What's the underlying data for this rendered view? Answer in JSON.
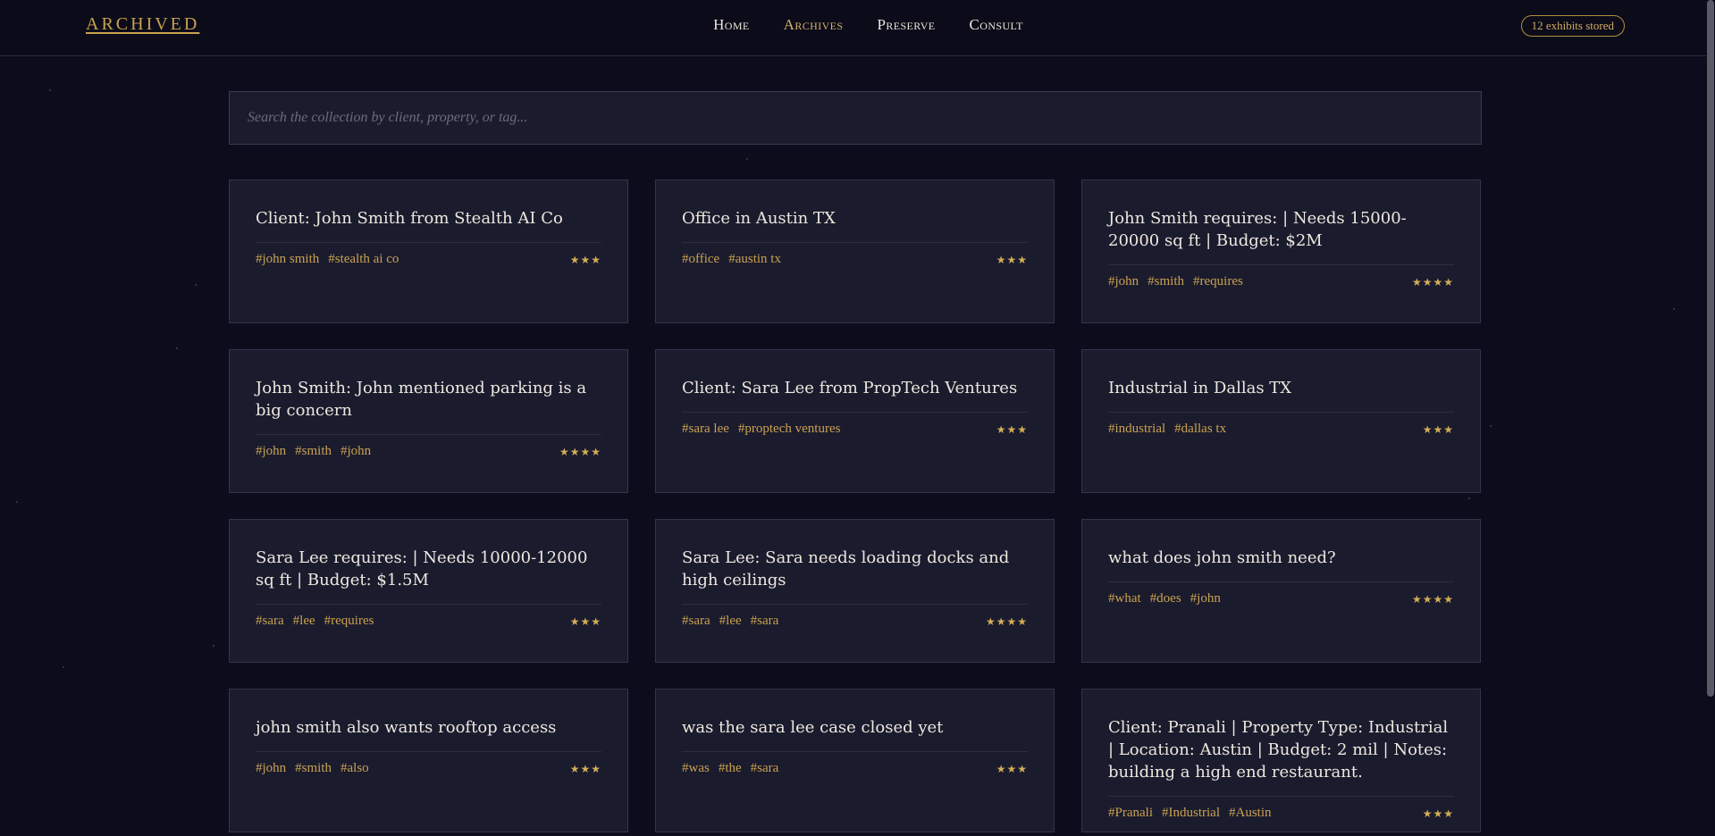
{
  "header": {
    "logo": "ARCHIVED",
    "nav": [
      "Home",
      "Archives",
      "Preserve",
      "Consult"
    ],
    "active_nav": "Archives",
    "counter": "12 exhibits stored"
  },
  "search": {
    "placeholder": "Search the collection by client, property, or tag...",
    "value": ""
  },
  "cards": [
    {
      "title": "Client: John Smith from Stealth AI Co",
      "tags": [
        "#john smith",
        "#stealth ai co"
      ],
      "rating": "★★★"
    },
    {
      "title": "Office in Austin TX",
      "tags": [
        "#office",
        "#austin tx"
      ],
      "rating": "★★★"
    },
    {
      "title": "John Smith requires: | Needs 15000-20000 sq ft | Budget: $2M",
      "tags": [
        "#john",
        "#smith",
        "#requires"
      ],
      "rating": "★★★★"
    },
    {
      "title": "John Smith: John mentioned parking is a big concern",
      "tags": [
        "#john",
        "#smith",
        "#john"
      ],
      "rating": "★★★★"
    },
    {
      "title": "Client: Sara Lee from PropTech Ventures",
      "tags": [
        "#sara lee",
        "#proptech ventures"
      ],
      "rating": "★★★"
    },
    {
      "title": "Industrial in Dallas TX",
      "tags": [
        "#industrial",
        "#dallas tx"
      ],
      "rating": "★★★"
    },
    {
      "title": "Sara Lee requires: | Needs 10000-12000 sq ft | Budget: $1.5M",
      "tags": [
        "#sara",
        "#lee",
        "#requires"
      ],
      "rating": "★★★"
    },
    {
      "title": "Sara Lee: Sara needs loading docks and high ceilings",
      "tags": [
        "#sara",
        "#lee",
        "#sara"
      ],
      "rating": "★★★★"
    },
    {
      "title": "what does john smith need?",
      "tags": [
        "#what",
        "#does",
        "#john"
      ],
      "rating": "★★★★"
    },
    {
      "title": "john smith also wants rooftop access",
      "tags": [
        "#john",
        "#smith",
        "#also"
      ],
      "rating": "★★★"
    },
    {
      "title": "was the sara lee case closed yet",
      "tags": [
        "#was",
        "#the",
        "#sara"
      ],
      "rating": "★★★"
    },
    {
      "title": "Client: Pranali | Property Type: Industrial | Location: Austin | Budget: 2 mil | Notes: building a high end restaurant.",
      "tags": [
        "#Pranali",
        "#Industrial",
        "#Austin"
      ],
      "rating": "★★★"
    }
  ],
  "colors": {
    "background": "#0c0c1c",
    "card": "#1b1b2e",
    "accent": "#c9a24f"
  }
}
